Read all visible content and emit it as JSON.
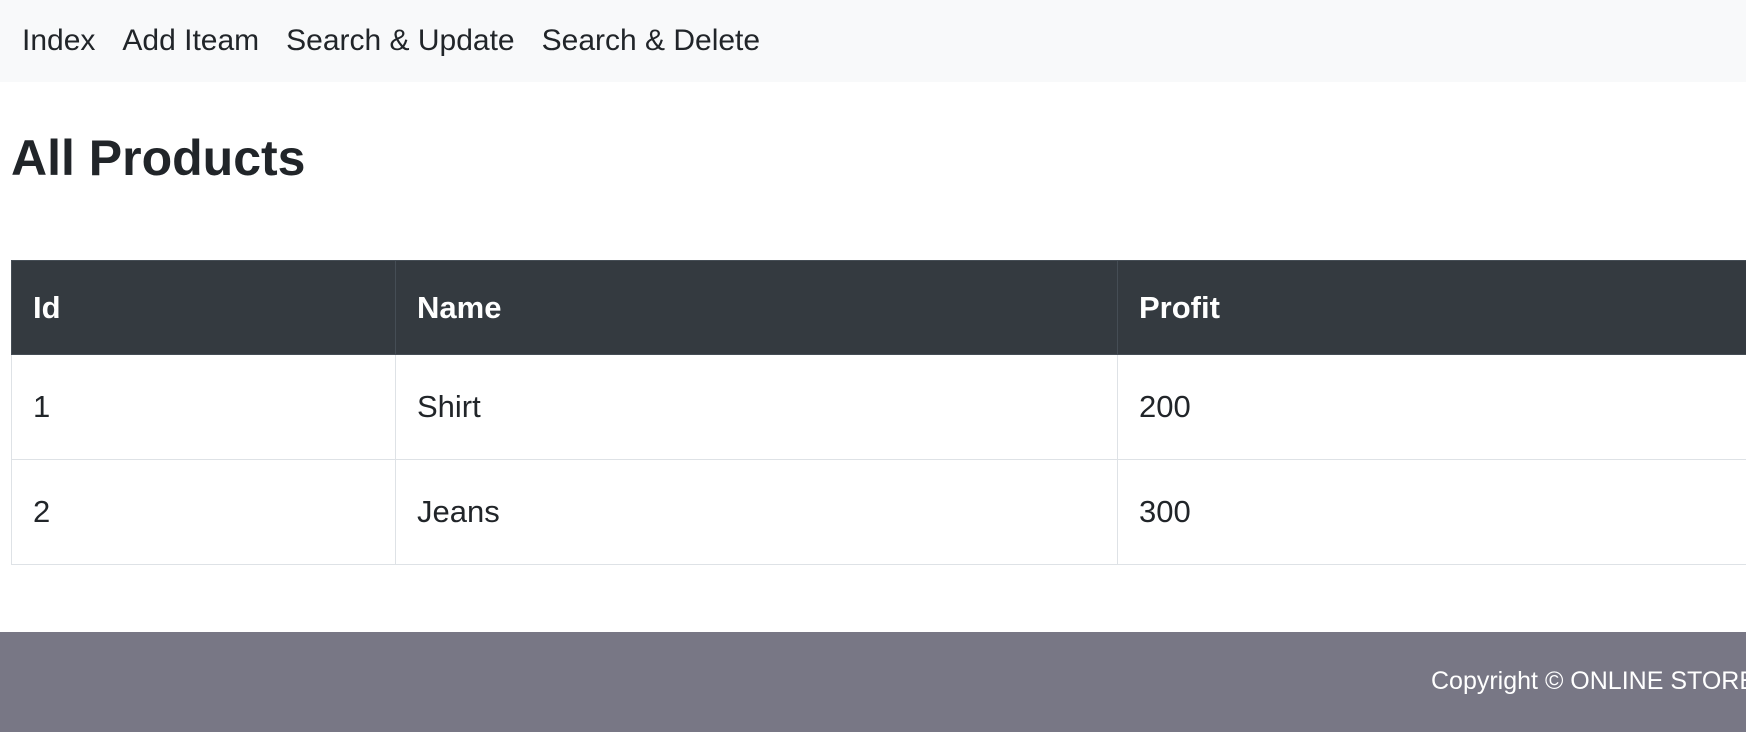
{
  "nav": {
    "items": [
      {
        "label": "Index"
      },
      {
        "label": "Add Iteam"
      },
      {
        "label": "Search & Update"
      },
      {
        "label": "Search & Delete"
      }
    ]
  },
  "page": {
    "title": "All Products"
  },
  "table": {
    "headers": [
      "Id",
      "Name",
      "Profit"
    ],
    "rows": [
      [
        "1",
        "Shirt",
        "200"
      ],
      [
        "2",
        "Jeans",
        "300"
      ]
    ]
  },
  "footer": {
    "text": "Copyright © ONLINE STORE"
  },
  "colors": {
    "nav_bg": "#f8f9fa",
    "table_header_bg": "#343a40",
    "footer_bg": "#787785"
  }
}
